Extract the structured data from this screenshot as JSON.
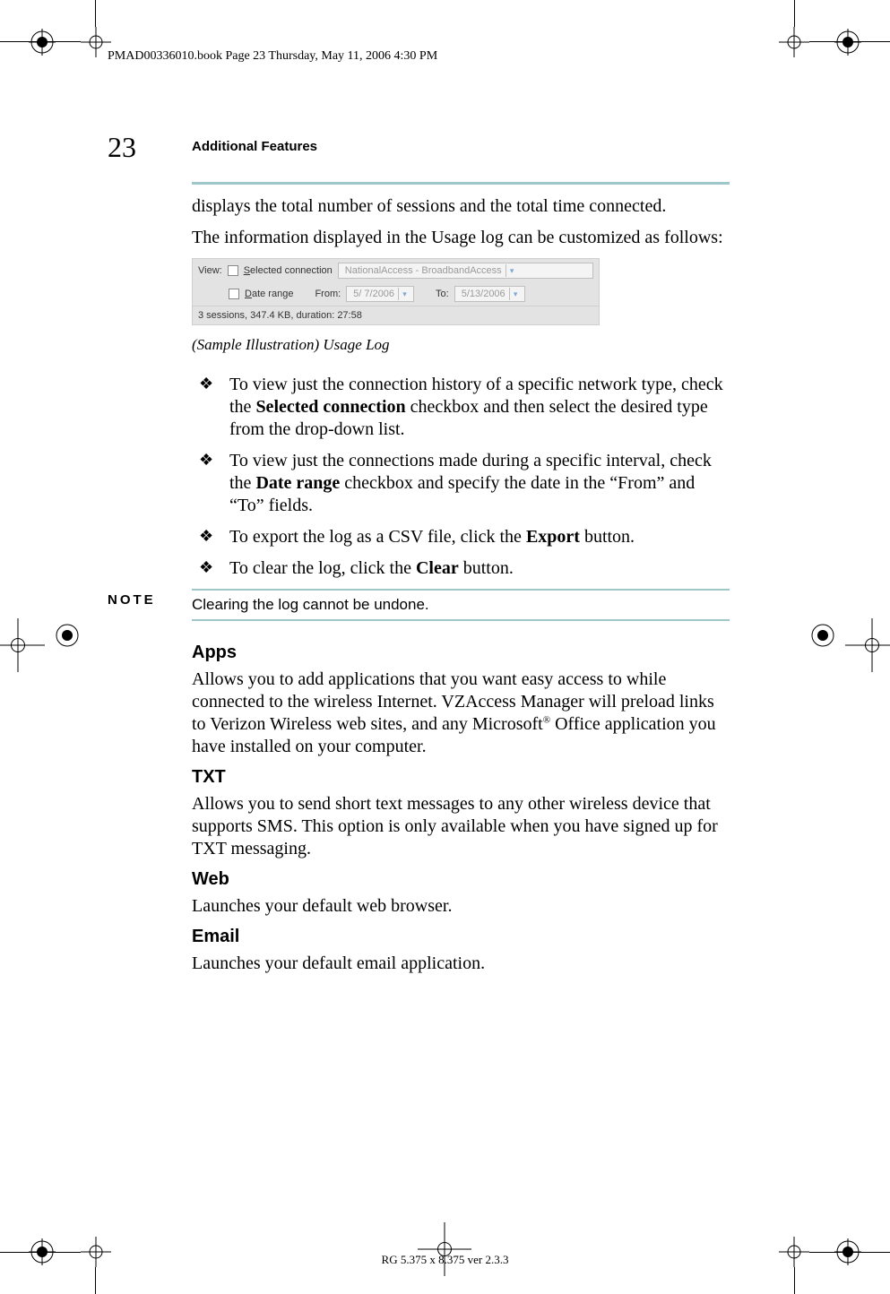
{
  "header": {
    "book_info": "PMAD00336010.book  Page 23  Thursday, May 11, 2006  4:30 PM"
  },
  "page": {
    "number": "23",
    "running_head": "Additional Features"
  },
  "intro": {
    "p1": "displays the total number of sessions and the total time connected.",
    "p2": "The information displayed in the Usage log can be customized as follows:"
  },
  "usage_log": {
    "view_label": "View:",
    "selected_label_pre": "S",
    "selected_label_post": "elected connection",
    "conn_value": "NationalAccess - BroadbandAccess",
    "date_label_pre": "D",
    "date_label_post": "ate range",
    "from_label": "From:",
    "from_value": "5/ 7/2006",
    "to_label": "To:",
    "to_value": "5/13/2006",
    "status": "3 sessions, 347.4 KB, duration: 27:58"
  },
  "caption": "(Sample Illustration) Usage Log",
  "bullets": [
    {
      "pre": "To view just the connection history of a specific network type, check the ",
      "bold": "Selected connection",
      "post": " checkbox and then select the desired type from the drop-down list."
    },
    {
      "pre": "To view just the connections made during a specific interval, check the ",
      "bold": "Date range",
      "post": " checkbox and specify the date in the “From” and “To” fields."
    },
    {
      "pre": "To export the log as a CSV file, click the ",
      "bold": "Export",
      "post": " button."
    },
    {
      "pre": "To clear the log, click the ",
      "bold": "Clear",
      "post": " button."
    }
  ],
  "note": {
    "label": "NOTE",
    "text": "Clearing the log cannot be undone."
  },
  "sections": {
    "apps": {
      "title": "Apps",
      "body_pre": "Allows you to add applications that you want easy access to while connected to the wireless Internet. VZAccess Manager will preload links to Verizon Wireless web sites, and any Microsoft",
      "sup": "®",
      "body_post": " Office application you have installed on your computer."
    },
    "txt": {
      "title": "TXT",
      "body": "Allows you to send short text messages to any other wireless device that supports SMS. This option is only available when you have signed up for TXT messaging."
    },
    "web": {
      "title": "Web",
      "body": "Launches your default web browser."
    },
    "email": {
      "title": "Email",
      "body": "Launches your default email application."
    }
  },
  "footer": "RG 5.375 x 8.375 ver 2.3.3"
}
